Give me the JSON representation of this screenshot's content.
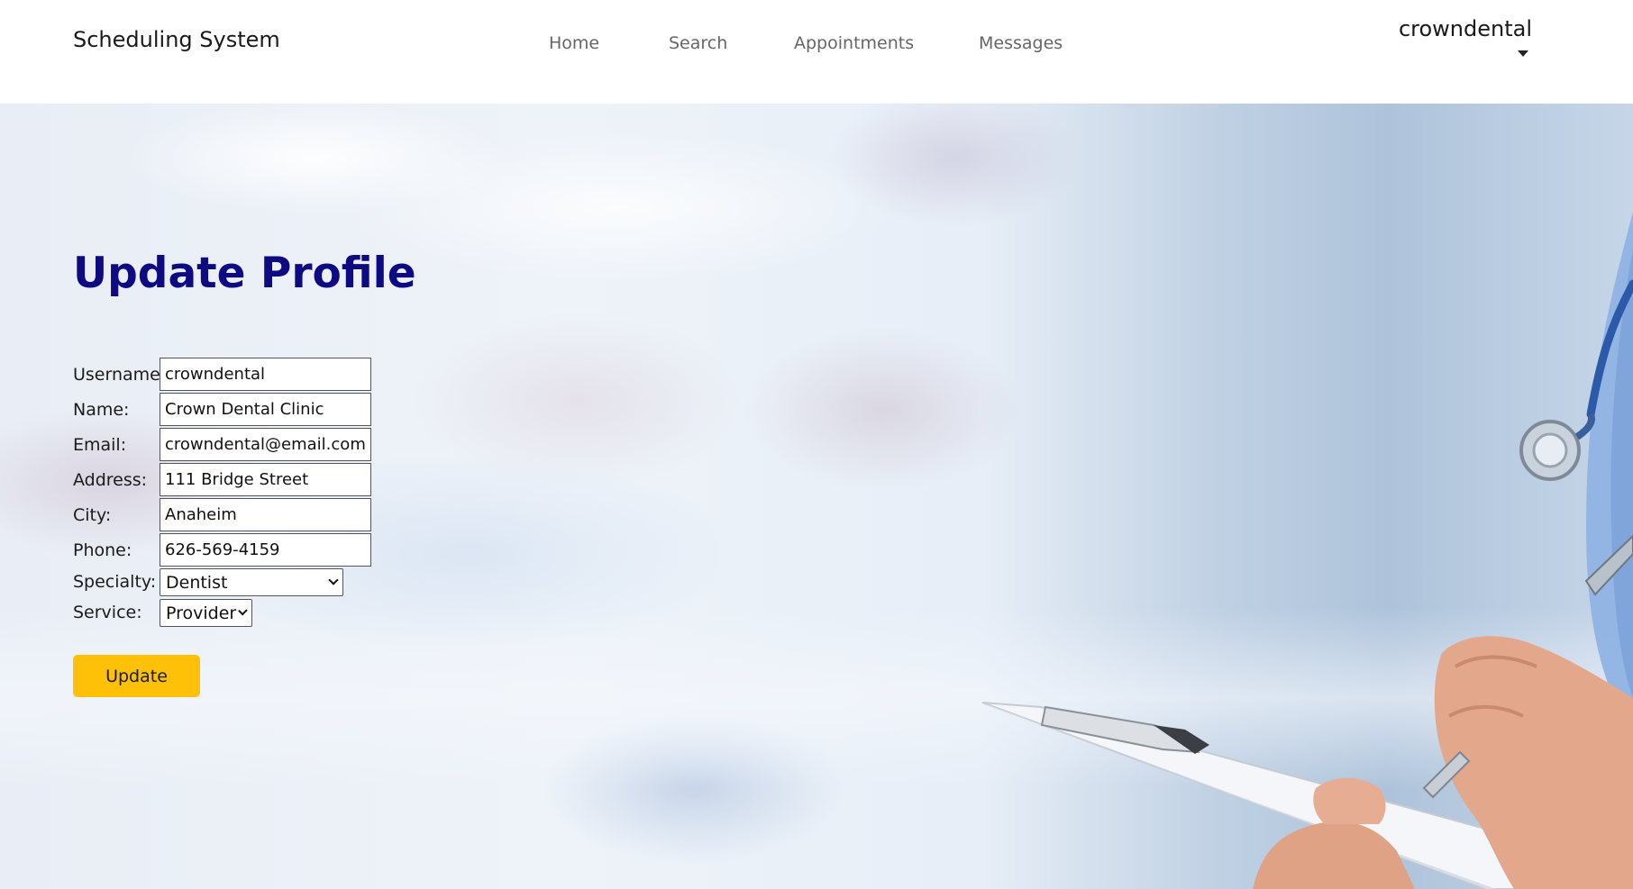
{
  "navbar": {
    "brand": "Scheduling System",
    "links": [
      {
        "label": "Home"
      },
      {
        "label": "Search"
      },
      {
        "label": "Appointments"
      },
      {
        "label": "Messages"
      }
    ],
    "user": {
      "name": "crowndental",
      "menu_icon": "caret-down-icon"
    }
  },
  "page": {
    "title": "Update Profile"
  },
  "form": {
    "username": {
      "label": "Username:",
      "value": "crowndental"
    },
    "name": {
      "label": "Name:",
      "value": "Crown Dental Clinic"
    },
    "email": {
      "label": "Email:",
      "value": "crowndental@email.com"
    },
    "address": {
      "label": "Address:",
      "value": "111 Bridge Street"
    },
    "city": {
      "label": "City:",
      "value": "Anaheim"
    },
    "phone": {
      "label": "Phone:",
      "value": "626-569-4159"
    },
    "specialty": {
      "label": "Specialty:",
      "value": "Dentist"
    },
    "service": {
      "label": "Service:",
      "value": "Provider"
    },
    "submit_label": "Update"
  },
  "colors": {
    "title": "#0d0a82",
    "button": "#ffc107",
    "navbar_bg": "#ffffff"
  }
}
